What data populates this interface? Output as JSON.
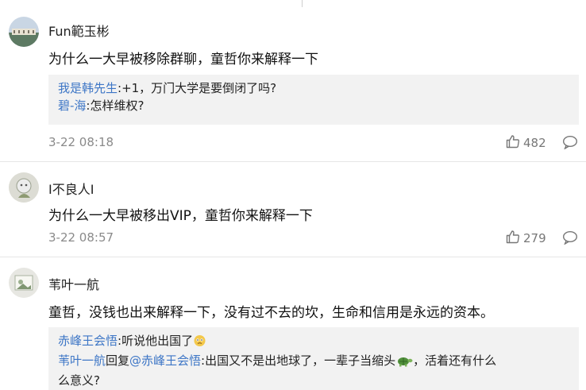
{
  "comments": [
    {
      "username": "Fun範玉彬",
      "text": "为什么一大早被移除群聊，童哲你来解释一下",
      "replies": [
        {
          "name": "我是韩先生",
          "text": ":+1，万门大学是要倒闭了吗?"
        },
        {
          "name": "碧-海",
          "text": ":怎样维权?"
        }
      ],
      "time": "3-22 08:18",
      "likes": "482"
    },
    {
      "username": "I不良人I",
      "text": "为什么一大早被移出VIP，童哲你来解释一下",
      "time": "3-22 08:57",
      "likes": "279"
    },
    {
      "username": "苇叶一航",
      "text": "童哲，没钱也出来解释一下，没有过不去的坎，生命和信用是永远的资本。",
      "replies": [
        {
          "name": "赤峰王会悟",
          "text": ":听说他出国了"
        },
        {
          "name": "苇叶一航",
          "mid": "回复",
          "mention": "@赤峰王会悟",
          "text": ":出国又不是出地球了，一辈子当缩头",
          "text2": "，活着还有什么",
          "text3": "么意义?"
        }
      ]
    }
  ],
  "icons": {
    "like": "thumbs-up-icon",
    "comment": "comment-bubble-icon",
    "emoji1": "confused-face-emoji",
    "emoji2": "turtle-emoji"
  }
}
